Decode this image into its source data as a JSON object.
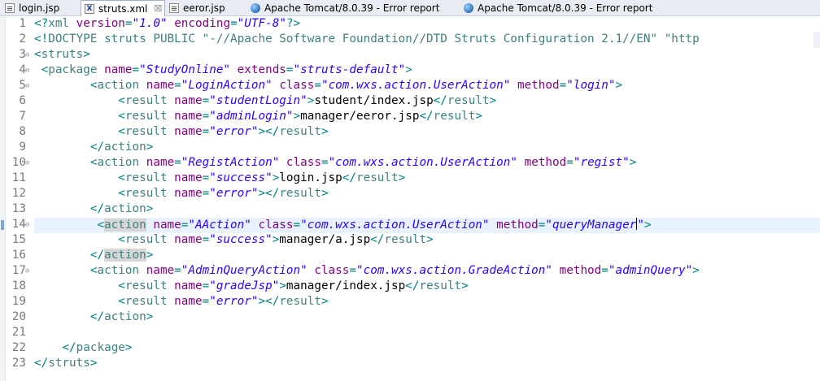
{
  "tabs": [
    {
      "label": "login.jsp",
      "icon": "jsp-file-icon",
      "active": false,
      "closable": false
    },
    {
      "label": "struts.xml",
      "icon": "xml-file-icon",
      "active": true,
      "closable": true
    },
    {
      "label": "eeror.jsp",
      "icon": "jsp-file-icon",
      "active": false,
      "closable": false
    },
    {
      "label": "Apache Tomcat/8.0.39 - Error report",
      "icon": "browser-globe-icon",
      "active": false,
      "closable": false
    },
    {
      "label": "Apache Tomcat/8.0.39 - Error report",
      "icon": "browser-globe-icon",
      "active": false,
      "closable": false
    }
  ],
  "editor": {
    "current_line": 14,
    "fold_lines": [
      3,
      4,
      5,
      10,
      14,
      17
    ],
    "lines": [
      {
        "n": "1",
        "tokens": [
          [
            "pun",
            "<?"
          ],
          [
            "tag",
            "xml"
          ],
          [
            "txt",
            " "
          ],
          [
            "attr",
            "version"
          ],
          [
            "pun",
            "="
          ],
          [
            "str",
            "\"1.0\""
          ],
          [
            "txt",
            " "
          ],
          [
            "attr",
            "encoding"
          ],
          [
            "pun",
            "="
          ],
          [
            "str",
            "\"UTF-8\""
          ],
          [
            "pun",
            "?>"
          ]
        ]
      },
      {
        "n": "2",
        "tokens": [
          [
            "pun",
            "<!"
          ],
          [
            "tag",
            "DOCTYPE struts "
          ],
          [
            "doc",
            "PUBLIC"
          ],
          [
            "txt",
            " "
          ],
          [
            "doc",
            "\"-//Apache Software Foundation//DTD Struts Configuration 2.1//EN\" \"http"
          ]
        ]
      },
      {
        "n": "3",
        "tokens": [
          [
            "pun",
            "<"
          ],
          [
            "tag",
            "struts"
          ],
          [
            "pun",
            ">"
          ]
        ]
      },
      {
        "n": "4",
        "tokens": [
          [
            "txt",
            " "
          ],
          [
            "pun",
            "<"
          ],
          [
            "tag",
            "package"
          ],
          [
            "txt",
            " "
          ],
          [
            "attr",
            "name"
          ],
          [
            "pun",
            "="
          ],
          [
            "str",
            "\"StudyOnline\""
          ],
          [
            "txt",
            " "
          ],
          [
            "attr",
            "extends"
          ],
          [
            "pun",
            "="
          ],
          [
            "str",
            "\"struts-default\""
          ],
          [
            "pun",
            ">"
          ]
        ]
      },
      {
        "n": "5",
        "tokens": [
          [
            "txt",
            "        "
          ],
          [
            "pun",
            "<"
          ],
          [
            "tag",
            "action"
          ],
          [
            "txt",
            " "
          ],
          [
            "attr",
            "name"
          ],
          [
            "pun",
            "="
          ],
          [
            "str",
            "\"LoginAction\""
          ],
          [
            "txt",
            " "
          ],
          [
            "attr",
            "class"
          ],
          [
            "pun",
            "="
          ],
          [
            "str",
            "\"com.wxs.action.UserAction\""
          ],
          [
            "txt",
            " "
          ],
          [
            "attr",
            "method"
          ],
          [
            "pun",
            "="
          ],
          [
            "str",
            "\"login\""
          ],
          [
            "pun",
            ">"
          ]
        ]
      },
      {
        "n": "6",
        "tokens": [
          [
            "txt",
            "            "
          ],
          [
            "pun",
            "<"
          ],
          [
            "tag",
            "result"
          ],
          [
            "txt",
            " "
          ],
          [
            "attr",
            "name"
          ],
          [
            "pun",
            "="
          ],
          [
            "str",
            "\"studentLogin\""
          ],
          [
            "pun",
            ">"
          ],
          [
            "txt",
            "student/index.jsp"
          ],
          [
            "pun",
            "</"
          ],
          [
            "tag",
            "result"
          ],
          [
            "pun",
            ">"
          ]
        ]
      },
      {
        "n": "7",
        "tokens": [
          [
            "txt",
            "            "
          ],
          [
            "pun",
            "<"
          ],
          [
            "tag",
            "result"
          ],
          [
            "txt",
            " "
          ],
          [
            "attr",
            "name"
          ],
          [
            "pun",
            "="
          ],
          [
            "str",
            "\"adminLogin\""
          ],
          [
            "pun",
            ">"
          ],
          [
            "txt",
            "manager/eeror.jsp"
          ],
          [
            "pun",
            "</"
          ],
          [
            "tag",
            "result"
          ],
          [
            "pun",
            ">"
          ]
        ]
      },
      {
        "n": "8",
        "tokens": [
          [
            "txt",
            "            "
          ],
          [
            "pun",
            "<"
          ],
          [
            "tag",
            "result"
          ],
          [
            "txt",
            " "
          ],
          [
            "attr",
            "name"
          ],
          [
            "pun",
            "="
          ],
          [
            "str",
            "\"error\""
          ],
          [
            "pun",
            "></"
          ],
          [
            "tag",
            "result"
          ],
          [
            "pun",
            ">"
          ]
        ]
      },
      {
        "n": "9",
        "tokens": [
          [
            "txt",
            "        "
          ],
          [
            "pun",
            "</"
          ],
          [
            "tag",
            "action"
          ],
          [
            "pun",
            ">"
          ]
        ]
      },
      {
        "n": "10",
        "tokens": [
          [
            "txt",
            "        "
          ],
          [
            "pun",
            "<"
          ],
          [
            "tag",
            "action"
          ],
          [
            "txt",
            " "
          ],
          [
            "attr",
            "name"
          ],
          [
            "pun",
            "="
          ],
          [
            "str",
            "\"RegistAction\""
          ],
          [
            "txt",
            " "
          ],
          [
            "attr",
            "class"
          ],
          [
            "pun",
            "="
          ],
          [
            "str",
            "\"com.wxs.action.UserAction\""
          ],
          [
            "txt",
            " "
          ],
          [
            "attr",
            "method"
          ],
          [
            "pun",
            "="
          ],
          [
            "str",
            "\"regist\""
          ],
          [
            "pun",
            ">"
          ]
        ]
      },
      {
        "n": "11",
        "tokens": [
          [
            "txt",
            "            "
          ],
          [
            "pun",
            "<"
          ],
          [
            "tag",
            "result"
          ],
          [
            "txt",
            " "
          ],
          [
            "attr",
            "name"
          ],
          [
            "pun",
            "="
          ],
          [
            "str",
            "\"success\""
          ],
          [
            "pun",
            ">"
          ],
          [
            "txt",
            "login.jsp"
          ],
          [
            "pun",
            "</"
          ],
          [
            "tag",
            "result"
          ],
          [
            "pun",
            ">"
          ]
        ]
      },
      {
        "n": "12",
        "tokens": [
          [
            "txt",
            "            "
          ],
          [
            "pun",
            "<"
          ],
          [
            "tag",
            "result"
          ],
          [
            "txt",
            " "
          ],
          [
            "attr",
            "name"
          ],
          [
            "pun",
            "="
          ],
          [
            "str",
            "\"error\""
          ],
          [
            "pun",
            "></"
          ],
          [
            "tag",
            "result"
          ],
          [
            "pun",
            ">"
          ]
        ]
      },
      {
        "n": "13",
        "tokens": [
          [
            "txt",
            "        "
          ],
          [
            "pun",
            "</"
          ],
          [
            "tag",
            "action"
          ],
          [
            "pun",
            ">"
          ]
        ]
      },
      {
        "n": "14",
        "tokens": [
          [
            "txt",
            "         "
          ],
          [
            "pun",
            "<"
          ],
          [
            "tagm",
            "action"
          ],
          [
            "txt",
            " "
          ],
          [
            "attr",
            "name"
          ],
          [
            "pun",
            "="
          ],
          [
            "str",
            "\"AAction\""
          ],
          [
            "txt",
            " "
          ],
          [
            "attr",
            "class"
          ],
          [
            "pun",
            "="
          ],
          [
            "str",
            "\"com.wxs.action.UserAction\""
          ],
          [
            "txt",
            " "
          ],
          [
            "attr",
            "method"
          ],
          [
            "pun",
            "="
          ],
          [
            "str",
            "\"queryManager"
          ],
          [
            "caret",
            ""
          ],
          [
            "str",
            "\""
          ],
          [
            "pun",
            ">"
          ]
        ]
      },
      {
        "n": "15",
        "tokens": [
          [
            "txt",
            "            "
          ],
          [
            "pun",
            "<"
          ],
          [
            "tag",
            "result"
          ],
          [
            "txt",
            " "
          ],
          [
            "attr",
            "name"
          ],
          [
            "pun",
            "="
          ],
          [
            "str",
            "\"success\""
          ],
          [
            "pun",
            ">"
          ],
          [
            "txt",
            "manager/a.jsp"
          ],
          [
            "pun",
            "</"
          ],
          [
            "tag",
            "result"
          ],
          [
            "pun",
            ">"
          ]
        ]
      },
      {
        "n": "16",
        "tokens": [
          [
            "txt",
            "        "
          ],
          [
            "pun",
            "</"
          ],
          [
            "tagm",
            "action"
          ],
          [
            "pun",
            ">"
          ]
        ]
      },
      {
        "n": "17",
        "tokens": [
          [
            "txt",
            "        "
          ],
          [
            "pun",
            "<"
          ],
          [
            "tag",
            "action"
          ],
          [
            "txt",
            " "
          ],
          [
            "attr",
            "name"
          ],
          [
            "pun",
            "="
          ],
          [
            "str",
            "\"AdminQueryAction\""
          ],
          [
            "txt",
            " "
          ],
          [
            "attr",
            "class"
          ],
          [
            "pun",
            "="
          ],
          [
            "str",
            "\"com.wxs.action.GradeAction\""
          ],
          [
            "txt",
            " "
          ],
          [
            "attr",
            "method"
          ],
          [
            "pun",
            "="
          ],
          [
            "str",
            "\"adminQuery\""
          ],
          [
            "pun",
            ">"
          ]
        ]
      },
      {
        "n": "18",
        "tokens": [
          [
            "txt",
            "            "
          ],
          [
            "pun",
            "<"
          ],
          [
            "tag",
            "result"
          ],
          [
            "txt",
            " "
          ],
          [
            "attr",
            "name"
          ],
          [
            "pun",
            "="
          ],
          [
            "str",
            "\"gradeJsp\""
          ],
          [
            "pun",
            ">"
          ],
          [
            "txt",
            "manager/index.jsp"
          ],
          [
            "pun",
            "</"
          ],
          [
            "tag",
            "result"
          ],
          [
            "pun",
            ">"
          ]
        ]
      },
      {
        "n": "19",
        "tokens": [
          [
            "txt",
            "            "
          ],
          [
            "pun",
            "<"
          ],
          [
            "tag",
            "result"
          ],
          [
            "txt",
            " "
          ],
          [
            "attr",
            "name"
          ],
          [
            "pun",
            "="
          ],
          [
            "str",
            "\"error\""
          ],
          [
            "pun",
            "></"
          ],
          [
            "tag",
            "result"
          ],
          [
            "pun",
            ">"
          ]
        ]
      },
      {
        "n": "20",
        "tokens": [
          [
            "txt",
            "        "
          ],
          [
            "pun",
            "</"
          ],
          [
            "tag",
            "action"
          ],
          [
            "pun",
            ">"
          ]
        ]
      },
      {
        "n": "21",
        "tokens": []
      },
      {
        "n": "22",
        "tokens": [
          [
            "txt",
            "    "
          ],
          [
            "pun",
            "</"
          ],
          [
            "tag",
            "package"
          ],
          [
            "pun",
            ">"
          ]
        ]
      },
      {
        "n": "23",
        "tokens": [
          [
            "pun",
            "</"
          ],
          [
            "tag",
            "struts"
          ],
          [
            "pun",
            ">"
          ]
        ]
      }
    ]
  }
}
